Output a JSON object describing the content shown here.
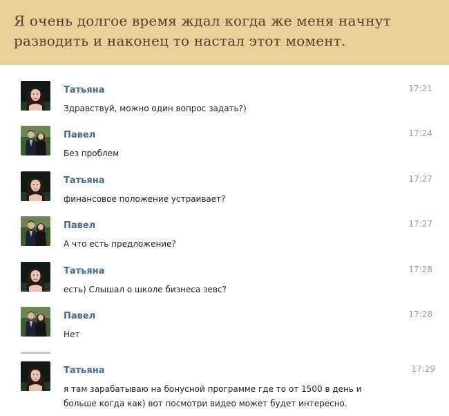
{
  "banner": {
    "text": "Я очень долгое время ждал когда же меня начнут разводить и наконец то настал этот момент."
  },
  "colors": {
    "banner_bg": "#e9cf98",
    "name": "#45688e",
    "time": "#9a9a9a"
  },
  "messages": [
    {
      "sender": "Татьяна",
      "time": "17:21",
      "text": "Здравствуй, можно один вопрос задать?)",
      "avatar": "tatyana-avatar"
    },
    {
      "sender": "Павел",
      "time": "17:24",
      "text": "Без проблем",
      "avatar": "pavel-avatar"
    },
    {
      "sender": "Татьяна",
      "time": "17:27",
      "text": "финансовое положение устраивает?",
      "avatar": "tatyana-avatar"
    },
    {
      "sender": "Павел",
      "time": "17:27",
      "text": "А что есть предложение?",
      "avatar": "pavel-avatar"
    },
    {
      "sender": "Татьяна",
      "time": "17:28",
      "text": "есть) Слышал о школе бизнеса зевс?",
      "avatar": "tatyana-avatar"
    },
    {
      "sender": "Павел",
      "time": "17:28",
      "text": "Нет",
      "avatar": "pavel-avatar"
    },
    {
      "sender": "Татьяна",
      "time": "17:29",
      "text": "я там зарабатываю на бонусной программе где то от 1500 в день и больше когда как) вот посмотри видео может будет интересно.",
      "avatar": "tatyana-avatar"
    }
  ]
}
